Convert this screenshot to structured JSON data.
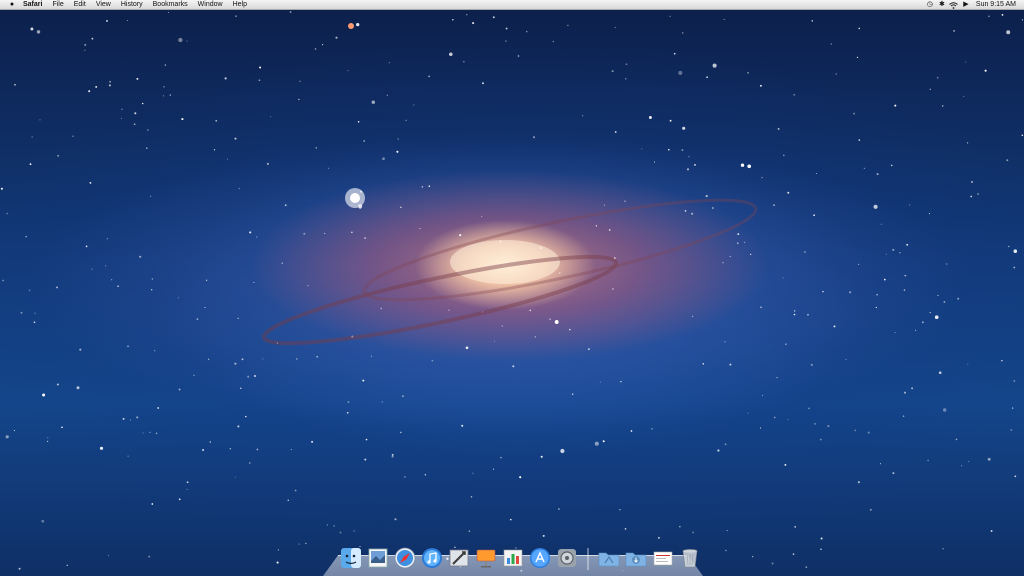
{
  "menubar": {
    "apple_icon": "apple-logo-icon",
    "app_name": "Safari",
    "menus": [
      "File",
      "Edit",
      "View",
      "History",
      "Bookmarks",
      "Window",
      "Help"
    ],
    "status_icons": [
      "time-machine-icon",
      "bluetooth-icon",
      "wifi-icon",
      "volume-icon"
    ],
    "clock": "Sun 9:15 AM"
  },
  "dock": {
    "apps": [
      {
        "name": "finder-icon"
      },
      {
        "name": "preview-icon"
      },
      {
        "name": "safari-icon"
      },
      {
        "name": "itunes-icon"
      },
      {
        "name": "mail-stamp-icon"
      },
      {
        "name": "keynote-icon"
      },
      {
        "name": "graphing-icon"
      },
      {
        "name": "app-store-icon"
      },
      {
        "name": "system-preferences-icon"
      }
    ],
    "stacks": [
      {
        "name": "applications-folder-icon"
      },
      {
        "name": "downloads-folder-icon"
      },
      {
        "name": "documents-stack-icon"
      },
      {
        "name": "trash-icon"
      }
    ]
  },
  "colors": {
    "menubar_bg": "#e6e6e6",
    "space_dark": "#0c1f4a",
    "space_blue": "#14458a",
    "galaxy_core": "#ffecd2"
  }
}
